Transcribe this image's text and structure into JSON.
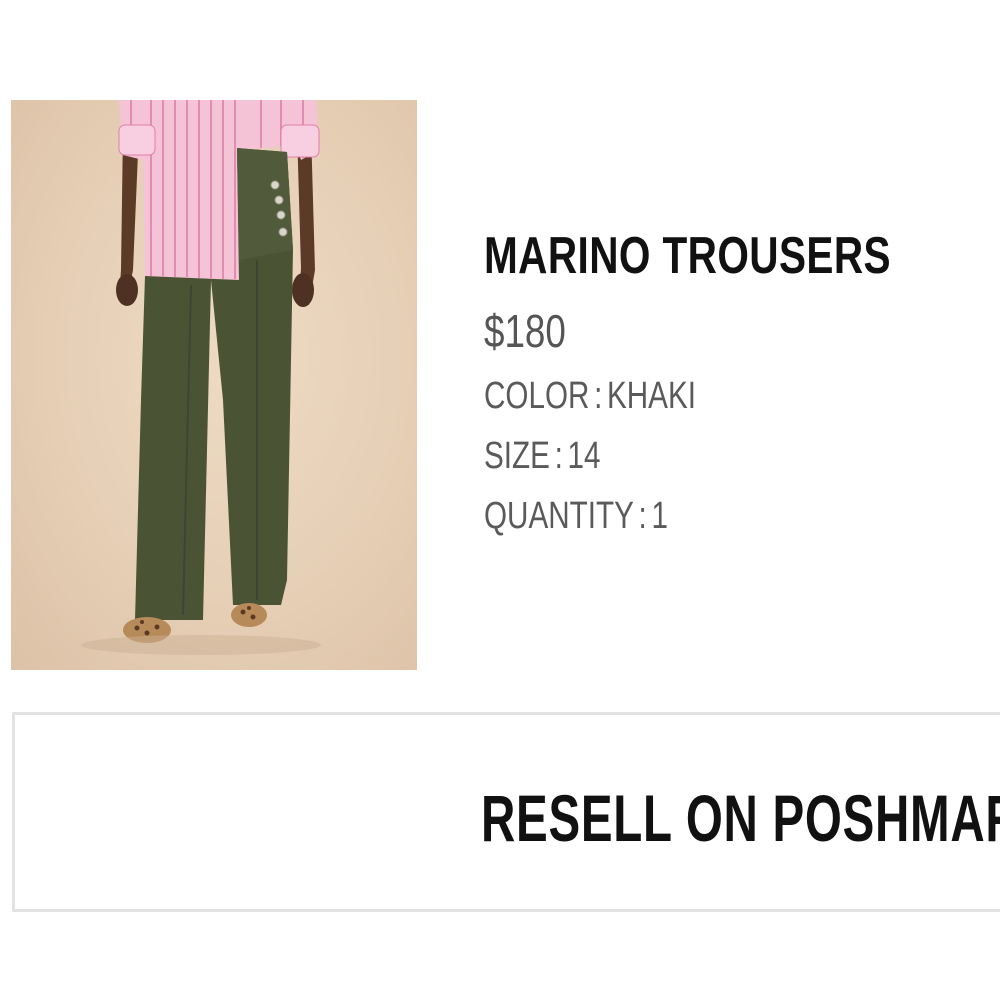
{
  "product": {
    "name": "MARINO TROUSERS",
    "price": "$180",
    "attributes": [
      {
        "label": "COLOR",
        "value": "KHAKI"
      },
      {
        "label": "SIZE",
        "value": "14"
      },
      {
        "label": "QUANTITY",
        "value": "1"
      }
    ],
    "separator": ":"
  },
  "resell_button": {
    "label": "RESELL ON POSHMARK"
  },
  "colors": {
    "background": "#ffffff",
    "title": "#111111",
    "secondary_text": "#555555",
    "button_border": "#e2e2e2",
    "photo_background": "#e6cfb6",
    "shirt": "#f2b8cf",
    "trousers": "#4b5335"
  }
}
